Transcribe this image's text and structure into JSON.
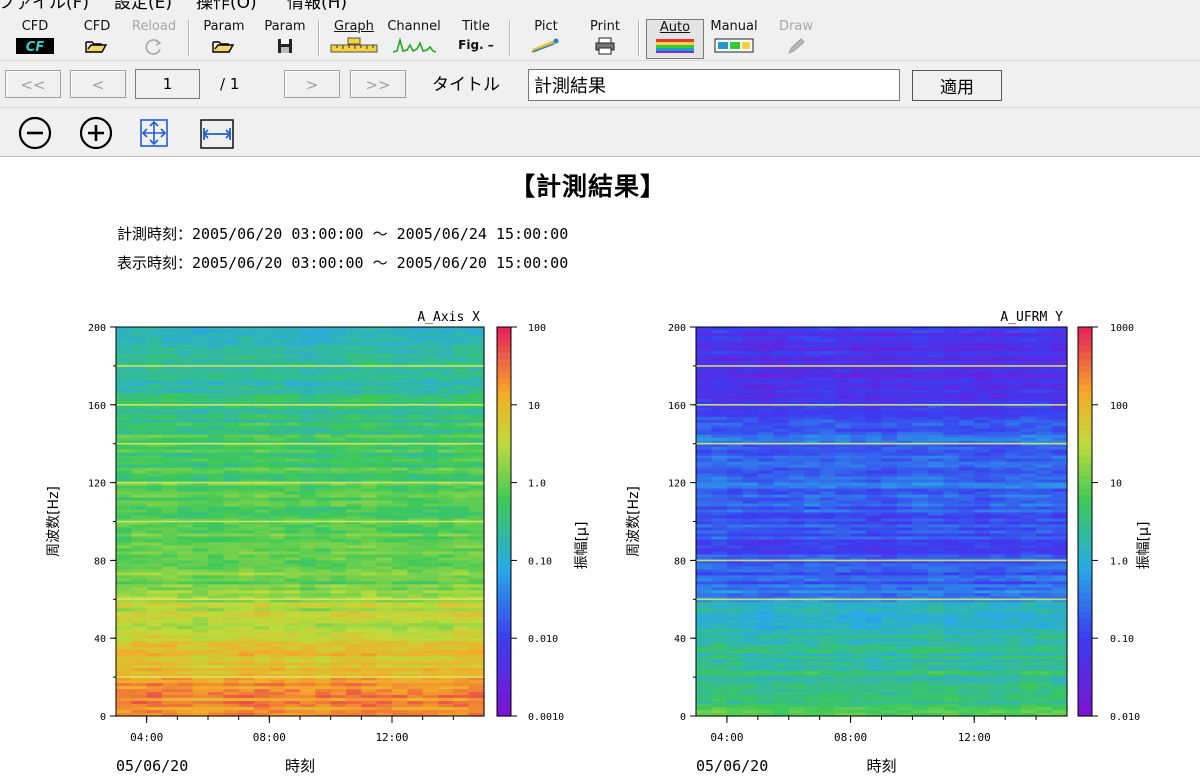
{
  "menu": {
    "items": [
      "ファイル(F)",
      "設定(E)",
      "操作(O)",
      "情報(H)"
    ]
  },
  "toolbar": {
    "buttons": [
      {
        "label": "CFD",
        "icon": "cfd-logo-icon",
        "disabled": false
      },
      {
        "label": "CFD",
        "icon": "open-folder-icon",
        "disabled": false
      },
      {
        "label": "Reload",
        "icon": "reload-icon",
        "disabled": true
      },
      {
        "label": "Param",
        "icon": "open-folder-icon",
        "disabled": false
      },
      {
        "label": "Param",
        "icon": "save-disk-icon",
        "disabled": false
      },
      {
        "label": "Graph",
        "icon": "graph-ruler-icon",
        "disabled": false
      },
      {
        "label": "Channel",
        "icon": "channel-spectrum-icon",
        "disabled": false
      },
      {
        "label": "Title",
        "icon": "title-fig-icon",
        "icon_text": "Fig. –",
        "disabled": false
      },
      {
        "label": "Pict",
        "icon": "picture-icon",
        "disabled": false
      },
      {
        "label": "Print",
        "icon": "printer-icon",
        "disabled": false
      },
      {
        "label": "Auto",
        "icon": "auto-colorbar-icon",
        "disabled": false,
        "pressed": true
      },
      {
        "label": "Manual",
        "icon": "manual-colorbar-icon",
        "disabled": false
      },
      {
        "label": "Draw",
        "icon": "pencil-icon",
        "disabled": true
      }
    ]
  },
  "navigation": {
    "first_label": "<<",
    "prev_label": "<",
    "page_value": "1",
    "page_total": "/ 1",
    "next_label": ">",
    "last_label": ">>",
    "title_label": "タイトル",
    "title_value": "計測結果",
    "apply_label": "適用"
  },
  "zoom_tools": [
    {
      "icon": "zoom-out-icon"
    },
    {
      "icon": "zoom-in-icon"
    },
    {
      "icon": "fit-all-icon"
    },
    {
      "icon": "fit-width-icon"
    }
  ],
  "report": {
    "title": "【計測結果】",
    "measure_time": "計測時刻：2005/06/20 03:00:00 ～ 2005/06/24 15:00:00",
    "display_time": "表示時刻：2005/06/20 03:00:00 ～ 2005/06/20 15:00:00"
  },
  "colors": {
    "panel": "#f0f0f0",
    "pressed_border": "#7a7a7a",
    "disabled_text": "#a8a8a8"
  },
  "chart_data": [
    {
      "type": "heatmap",
      "title": "A_Axis X",
      "xlabel": "時刻",
      "ylabel": "周波数[Hz]",
      "date_label": "05/06/20",
      "x_ticks": [
        "04:00",
        "08:00",
        "12:00"
      ],
      "x_range": [
        "03:00",
        "15:00"
      ],
      "y_ticks": [
        0,
        40,
        80,
        120,
        160,
        200
      ],
      "ylim": [
        0,
        200
      ],
      "colorbar": {
        "label": "振幅[μ]",
        "scale": "log",
        "ticks": [
          "100",
          "10",
          "1.0",
          "0.10",
          "0.010",
          "0.0010"
        ],
        "min": 0.001,
        "max": 100
      },
      "amplitude_profile": {
        "freq_hz": [
          0,
          10,
          20,
          40,
          58,
          62,
          80,
          100,
          120,
          140,
          160,
          175,
          185,
          200
        ],
        "amplitude": [
          25,
          18,
          12,
          4,
          2.5,
          1.4,
          0.9,
          0.8,
          0.7,
          0.55,
          0.3,
          0.2,
          0.15,
          0.12
        ]
      },
      "line_peaks_hz": [
        20,
        60,
        100,
        120,
        140,
        160,
        180
      ]
    },
    {
      "type": "heatmap",
      "title": "A_UFRM Y",
      "xlabel": "時刻",
      "ylabel": "周波数[Hz]",
      "date_label": "05/06/20",
      "x_ticks": [
        "04:00",
        "08:00",
        "12:00"
      ],
      "x_range": [
        "03:00",
        "15:00"
      ],
      "y_ticks": [
        0,
        40,
        80,
        120,
        160,
        200
      ],
      "ylim": [
        0,
        200
      ],
      "colorbar": {
        "label": "振幅[μ]",
        "scale": "log",
        "ticks": [
          "1000",
          "100",
          "10",
          "1.0",
          "0.10",
          "0.010"
        ],
        "min": 0.01,
        "max": 1000
      },
      "amplitude_profile": {
        "freq_hz": [
          0,
          20,
          40,
          58,
          62,
          80,
          100,
          120,
          140,
          160,
          175,
          185,
          200
        ],
        "amplitude": [
          5,
          3,
          1.8,
          1.0,
          0.3,
          0.12,
          0.15,
          0.22,
          0.25,
          0.08,
          0.04,
          0.05,
          0.06
        ]
      },
      "line_peaks_hz": [
        60,
        80,
        140,
        160,
        180
      ]
    }
  ]
}
